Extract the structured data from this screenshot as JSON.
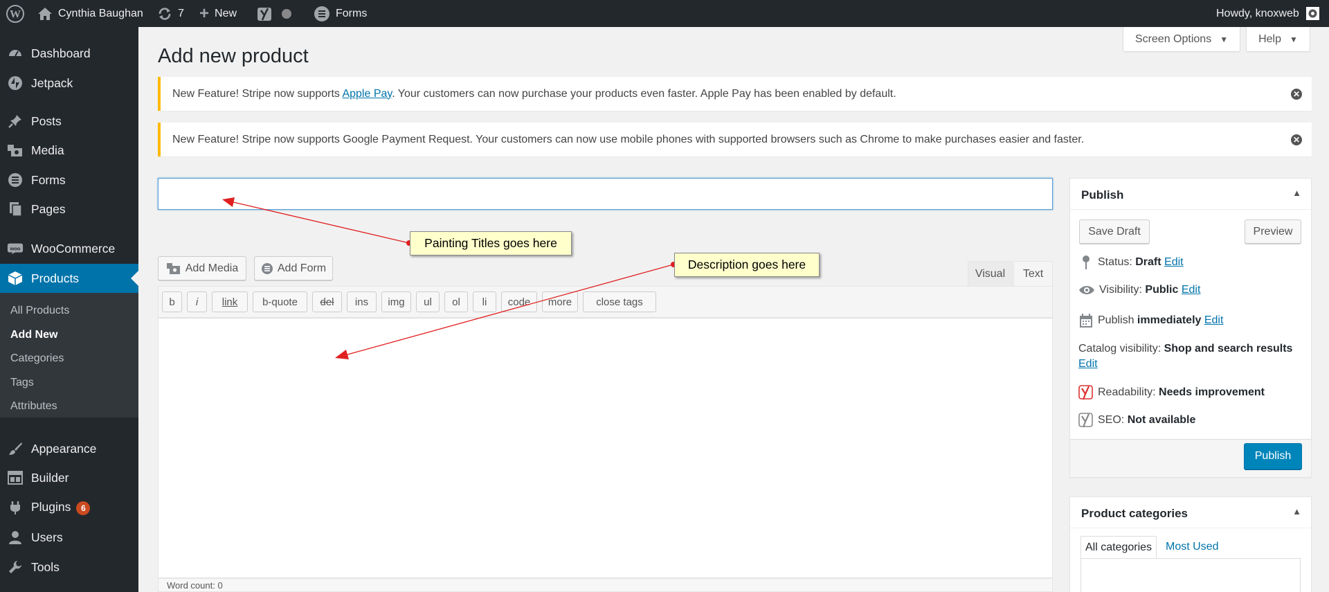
{
  "admin_bar": {
    "site_name": "Cynthia Baughan",
    "updates_count": "7",
    "new_label": "New",
    "forms_label": "Forms",
    "howdy": "Howdy, knoxweb",
    "icons": [
      "wordpress-icon",
      "home-icon",
      "updates-icon",
      "plus-icon",
      "yoast-icon",
      "status-dot-icon",
      "forms-icon",
      "avatar"
    ]
  },
  "sidebar": {
    "items": {
      "dashboard": "Dashboard",
      "jetpack": "Jetpack",
      "posts": "Posts",
      "media": "Media",
      "forms": "Forms",
      "pages": "Pages",
      "woocommerce": "WooCommerce",
      "products": "Products",
      "appearance": "Appearance",
      "builder": "Builder",
      "plugins": "Plugins",
      "plugins_badge": "6",
      "users": "Users",
      "tools": "Tools"
    },
    "submenu": {
      "all_products": "All Products",
      "add_new": "Add New",
      "categories": "Categories",
      "tags": "Tags",
      "attributes": "Attributes"
    },
    "active_color": "#0073aa"
  },
  "screen_options": "Screen Options",
  "help": "Help",
  "page_title": "Add new product",
  "notices": {
    "n1_prefix": "New Feature! Stripe now supports ",
    "n1_link": "Apple Pay",
    "n1_suffix": ". Your customers can now purchase your products even faster. Apple Pay has been enabled by default.",
    "n2": "New Feature! Stripe now supports Google Payment Request. Your customers can now use mobile phones with supported browsers such as Chrome to make purchases easier and faster.",
    "border_color": "#ffb900"
  },
  "title_input": {
    "value": "",
    "placeholder": ""
  },
  "editor": {
    "add_media": "Add Media",
    "add_form": "Add Form",
    "tab_visual": "Visual",
    "tab_text": "Text",
    "quicktags": [
      "b",
      "i",
      "link",
      "b-quote",
      "del",
      "ins",
      "img",
      "ul",
      "ol",
      "li",
      "code",
      "more",
      "close tags"
    ],
    "content": "",
    "word_count_label": "Word count: 0"
  },
  "callouts": {
    "title_note": "Painting Titles goes here",
    "description_note": "Description goes here",
    "arrow_color": "#e02020"
  },
  "publish": {
    "heading": "Publish",
    "save_draft": "Save Draft",
    "preview": "Preview",
    "status_label": "Status: ",
    "status_value": "Draft",
    "visibility_label": "Visibility: ",
    "visibility_value": "Public",
    "publish_label": "Publish ",
    "publish_value": "immediately",
    "catalog_label": "Catalog visibility: ",
    "catalog_value": "Shop and search results",
    "readability_label": "Readability: ",
    "readability_value": "Needs improvement",
    "seo_label": "SEO: ",
    "seo_value": "Not available",
    "edit": "Edit",
    "publish_button": "Publish",
    "publish_button_color": "#0085ba"
  },
  "categories": {
    "heading": "Product categories",
    "tab_all": "All categories",
    "tab_most_used": "Most Used"
  }
}
